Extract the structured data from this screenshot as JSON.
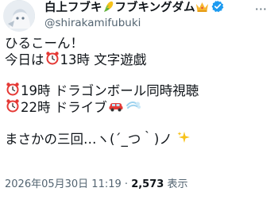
{
  "author": {
    "display_name_1": "白上フブキ",
    "display_name_2": "フブキングダム",
    "handle": "@shirakamifubuki",
    "icons": [
      "corn-emoji-icon",
      "crown-emoji-icon",
      "verified-badge-icon"
    ]
  },
  "menu": {
    "more_label": "···"
  },
  "tweet": {
    "line1": "ひるこーん！",
    "line2_pre": "今日は",
    "line2_post": "13時 文字遊戯",
    "line3_post": "19時 ドラゴンボール同時視聴",
    "line4_post": "22時 ドライブ",
    "line5": "まさかの三回…ヽ(´_つ｀)ノ",
    "icons": [
      "alarm-clock-icon",
      "car-icon",
      "dash-icon",
      "sparkles-icon"
    ]
  },
  "meta": {
    "timestamp": "2026年05月30日 11:19",
    "separator": "·",
    "views_count": "2,573",
    "views_label": "表示"
  },
  "colors": {
    "text": "#0f1419",
    "secondary": "#536471",
    "verified": "#1d9bf0"
  }
}
